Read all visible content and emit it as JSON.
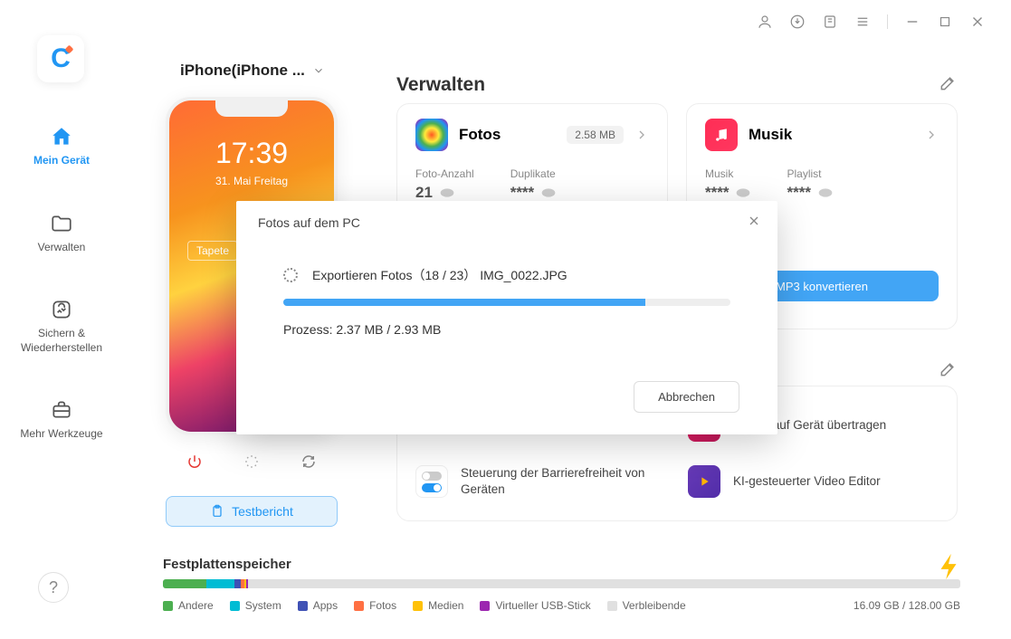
{
  "titlebar": {},
  "device_selector": {
    "label": "iPhone(iPhone ..."
  },
  "sidebar": {
    "items": [
      {
        "label": "Mein Gerät"
      },
      {
        "label": "Verwalten"
      },
      {
        "label": "Sichern & Wiederherstellen"
      },
      {
        "label": "Mehr Werkzeuge"
      }
    ]
  },
  "phone": {
    "time": "17:39",
    "date": "31. Mai Freitag",
    "wallpaper_btn": "Tapete"
  },
  "testbericht": "Testbericht",
  "main_title": "Verwalten",
  "cards": {
    "fotos": {
      "title": "Fotos",
      "size": "2.58 MB",
      "stat1_label": "Foto-Anzahl",
      "stat1_value": "21",
      "stat2_label": "Duplikate",
      "stat2_value": "****"
    },
    "musik": {
      "title": "Musik",
      "stat1_label": "Musik",
      "stat1_value": "****",
      "stat2_label": "Playlist",
      "stat2_value": "****",
      "btn": "MP3 konvertieren"
    }
  },
  "shortcuts": [
    {
      "label": "Steuerung der Barrierefreiheit von Geräten"
    },
    {
      "label": "iTunes auf Gerät übertragen"
    },
    {
      "label": "KI-gesteuerter Video Editor"
    }
  ],
  "storage": {
    "title": "Festplattenspeicher",
    "legend": [
      "Andere",
      "System",
      "Apps",
      "Fotos",
      "Medien",
      "Virtueller USB-Stick",
      "Verbleibende"
    ],
    "colors": [
      "#4caf50",
      "#00bcd4",
      "#3f51b5",
      "#ff7043",
      "#ffc107",
      "#9c27b0",
      "#e0e0e0"
    ],
    "segments": [
      5.5,
      3.5,
      0.8,
      0.4,
      0.3,
      0.2,
      89.3
    ],
    "used": "16.09 GB",
    "total": "128.00 GB"
  },
  "dialog": {
    "title": "Fotos auf dem PC",
    "status_prefix": "Exportieren Fotos",
    "current": 18,
    "total": 23,
    "filename": "IMG_0022.JPG",
    "process_label": "Prozess:",
    "done_mb": "2.37 MB",
    "total_mb": "2.93 MB",
    "cancel": "Abbrechen",
    "status_full": "Exportieren Fotos（18 / 23） IMG_0022.JPG",
    "process_full": "Prozess: 2.37 MB   /   2.93 MB"
  }
}
